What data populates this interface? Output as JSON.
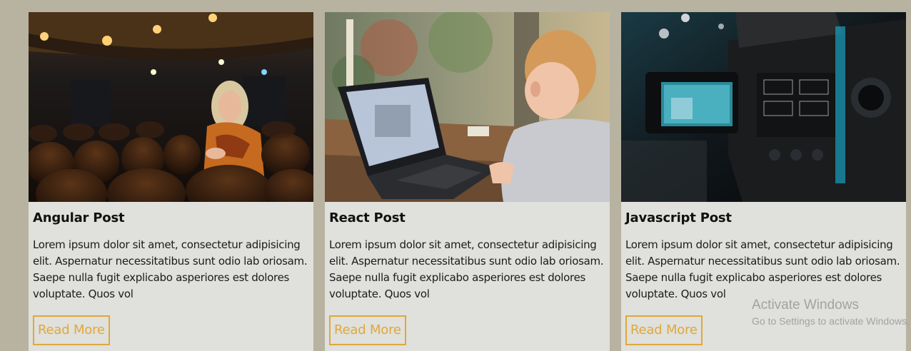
{
  "cards": [
    {
      "title": "Angular Post",
      "text": "Lorem ipsum dolor sit amet, consectetur adipisicing elit. Aspernatur necessitatibus sunt odio lab oriosam. Saepe nulla fugit explicabo asperiores est dolores voluptate. Quos vol",
      "button_label": "Read More",
      "image_subject": "woman in theater seats"
    },
    {
      "title": "React Post",
      "text": "Lorem ipsum dolor sit amet, consectetur adipisicing elit. Aspernatur necessitatibus sunt odio lab oriosam. Saepe nulla fugit explicabo asperiores est dolores voluptate. Quos vol",
      "button_label": "Read More",
      "image_subject": "child using laptop"
    },
    {
      "title": "Javascript Post",
      "text": "Lorem ipsum dolor sit amet, consectetur adipisicing elit. Aspernatur necessitatibus sunt odio lab oriosam. Saepe nulla fugit explicabo asperiores est dolores voluptate. Quos vol",
      "button_label": "Read More",
      "image_subject": "video camera viewfinder"
    }
  ],
  "watermark": {
    "title": "Activate Windows",
    "subtitle": "Go to Settings to activate Windows."
  },
  "colors": {
    "page_background": "#b8b2a0",
    "card_background": "#e0e0dc",
    "accent": "#e0a83a"
  }
}
